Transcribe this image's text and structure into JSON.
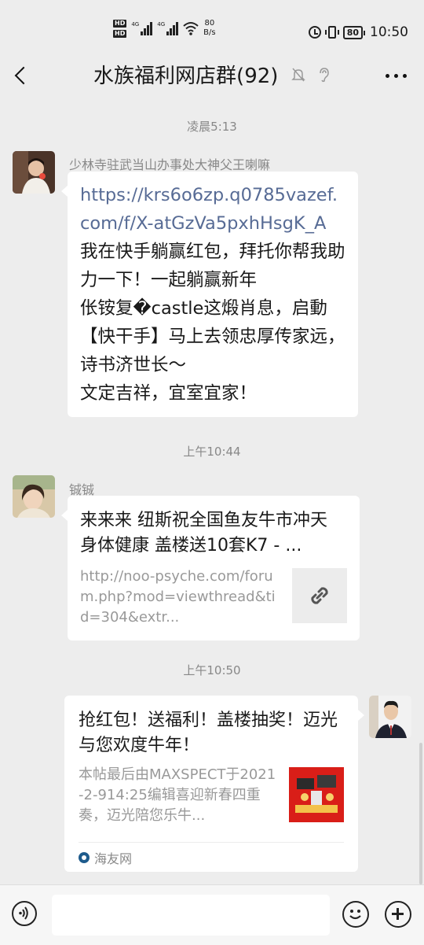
{
  "status_bar": {
    "hd1": "HD",
    "hd2": "HD",
    "sim1_label": "4G",
    "sim2_label": "4G",
    "net_speed_value": "80",
    "net_speed_unit": "B/s",
    "battery": "80",
    "time": "10:50"
  },
  "header": {
    "title": "水族福利网店群(92)"
  },
  "messages": [
    {
      "timestamp": "凌晨5:13",
      "sender": "少林寺驻武当山办事处大神父王喇嘛",
      "link": "https://krs6o6zp.q0785vazef.com/f/X-atGzVa5pxhHsgK_A",
      "body": "我在快手躺赢红包，拜托你帮我助力一下！一起躺赢新年\n伥铵复�castle这煅肖息，启動【快干手】马上去领忠厚传家远，诗书济世长～\n文定吉祥，宜室宜家！"
    },
    {
      "timestamp": "上午10:44",
      "sender": "铖铖",
      "card_title": "来来来 纽斯祝全国鱼友牛市冲天 身体健康 盖楼送10套K7 - ...",
      "card_desc": "http://noo-psyche.com/forum.php?mod=viewthread&tid=304&extr..."
    },
    {
      "timestamp": "上午10:50",
      "card_title": "抢红包！送福利！盖楼抽奖！迈光与您欢度牛年！",
      "card_desc": "本帖最后由MAXSPECT于2021-2-914:25编辑喜迎新春四重奏，迈光陪您乐牛...",
      "card_source": "海友网"
    }
  ],
  "input": {
    "placeholder": ""
  },
  "colors": {
    "background": "#ededed",
    "link": "#576b95",
    "bubble": "#ffffff"
  }
}
